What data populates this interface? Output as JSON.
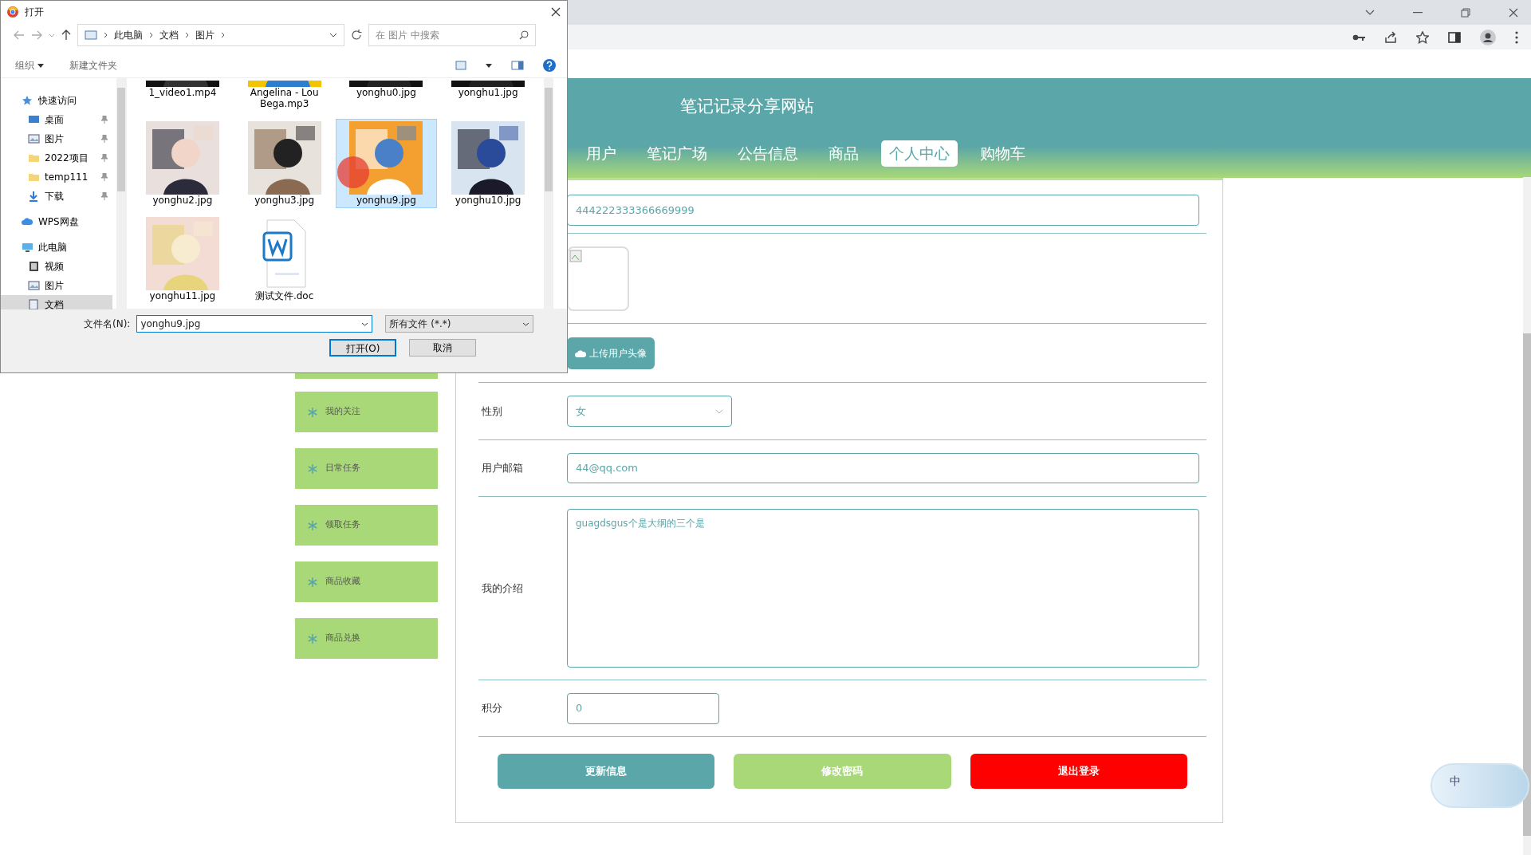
{
  "site": {
    "title": "笔记记录分享网站",
    "nav": [
      {
        "label": "用户",
        "selected": false
      },
      {
        "label": "笔记广场",
        "selected": false
      },
      {
        "label": "公告信息",
        "selected": false
      },
      {
        "label": "商品",
        "selected": false
      },
      {
        "label": "个人中心",
        "selected": true
      },
      {
        "label": "购物车",
        "selected": false
      }
    ]
  },
  "sidebar": {
    "items": [
      {
        "label": "我的关注"
      },
      {
        "label": "日常任务"
      },
      {
        "label": "领取任务"
      },
      {
        "label": "商品收藏"
      },
      {
        "label": "商品兑换"
      }
    ]
  },
  "profile_form": {
    "account_value": "444222333366669999",
    "upload_button": "上传用户头像",
    "fields": [
      {
        "kind": "select",
        "label": "性别",
        "value": "女"
      },
      {
        "kind": "input",
        "label": "用户邮箱",
        "value": "44@qq.com"
      },
      {
        "kind": "textarea",
        "label": "我的介绍",
        "value": "guagdsgus个是大纲的三个是"
      },
      {
        "kind": "short",
        "label": "积分",
        "value": "0"
      }
    ],
    "buttons": [
      {
        "label": "更新信息",
        "kind": "primary"
      },
      {
        "label": "修改密码",
        "kind": "secondary"
      },
      {
        "label": "退出登录",
        "kind": "danger"
      }
    ]
  },
  "file_dialog": {
    "title": "打开",
    "breadcrumb": [
      "此电脑",
      "文档",
      "图片"
    ],
    "search_placeholder": "在 图片 中搜索",
    "organize": "组织",
    "new_folder": "新建文件夹",
    "nav_items": [
      {
        "label": "快速访问",
        "kind": "star",
        "selected": false,
        "children": [
          {
            "label": "桌面",
            "kind": "desktop",
            "selected": false,
            "pinned": true
          },
          {
            "label": "图片",
            "kind": "pictures",
            "selected": false,
            "pinned": true
          },
          {
            "label": "2022项目",
            "kind": "folder",
            "selected": false,
            "pinned": true
          },
          {
            "label": "temp111",
            "kind": "folder",
            "selected": false,
            "pinned": true
          },
          {
            "label": "下载",
            "kind": "download",
            "selected": false,
            "pinned": true
          }
        ]
      },
      {
        "label": "WPS网盘",
        "kind": "cloud",
        "selected": false
      },
      {
        "label": "此电脑",
        "kind": "pc",
        "selected": false,
        "children": [
          {
            "label": "视频",
            "kind": "video",
            "selected": false,
            "pinned": false
          },
          {
            "label": "图片",
            "kind": "pictures",
            "selected": false,
            "pinned": false
          },
          {
            "label": "文档",
            "kind": "document",
            "selected": true,
            "pinned": false
          }
        ]
      }
    ],
    "files": [
      {
        "name": "1_video1.mp4",
        "kind": "video",
        "selected": false
      },
      {
        "name": "Angelina - Lou Bega.mp3",
        "kind": "audio",
        "selected": false
      },
      {
        "name": "yonghu0.jpg",
        "kind": "dark",
        "selected": false
      },
      {
        "name": "yonghu1.jpg",
        "kind": "dark",
        "selected": false
      },
      {
        "name": "yonghu2.jpg",
        "kind": "portrait",
        "selected": false
      },
      {
        "name": "yonghu3.jpg",
        "kind": "gallery",
        "selected": false
      },
      {
        "name": "yonghu9.jpg",
        "kind": "orange",
        "selected": true
      },
      {
        "name": "yonghu10.jpg",
        "kind": "blue",
        "selected": false
      },
      {
        "name": "yonghu11.jpg",
        "kind": "pale",
        "selected": false
      },
      {
        "name": "测试文件.doc",
        "kind": "doc",
        "selected": false
      }
    ],
    "filename_label": "文件名(N):",
    "filename_value": "yonghu9.jpg",
    "filter": "所有文件 (*.*)",
    "buttons": [
      "打开(O)",
      "取消"
    ]
  },
  "ime": {
    "label": "中"
  }
}
